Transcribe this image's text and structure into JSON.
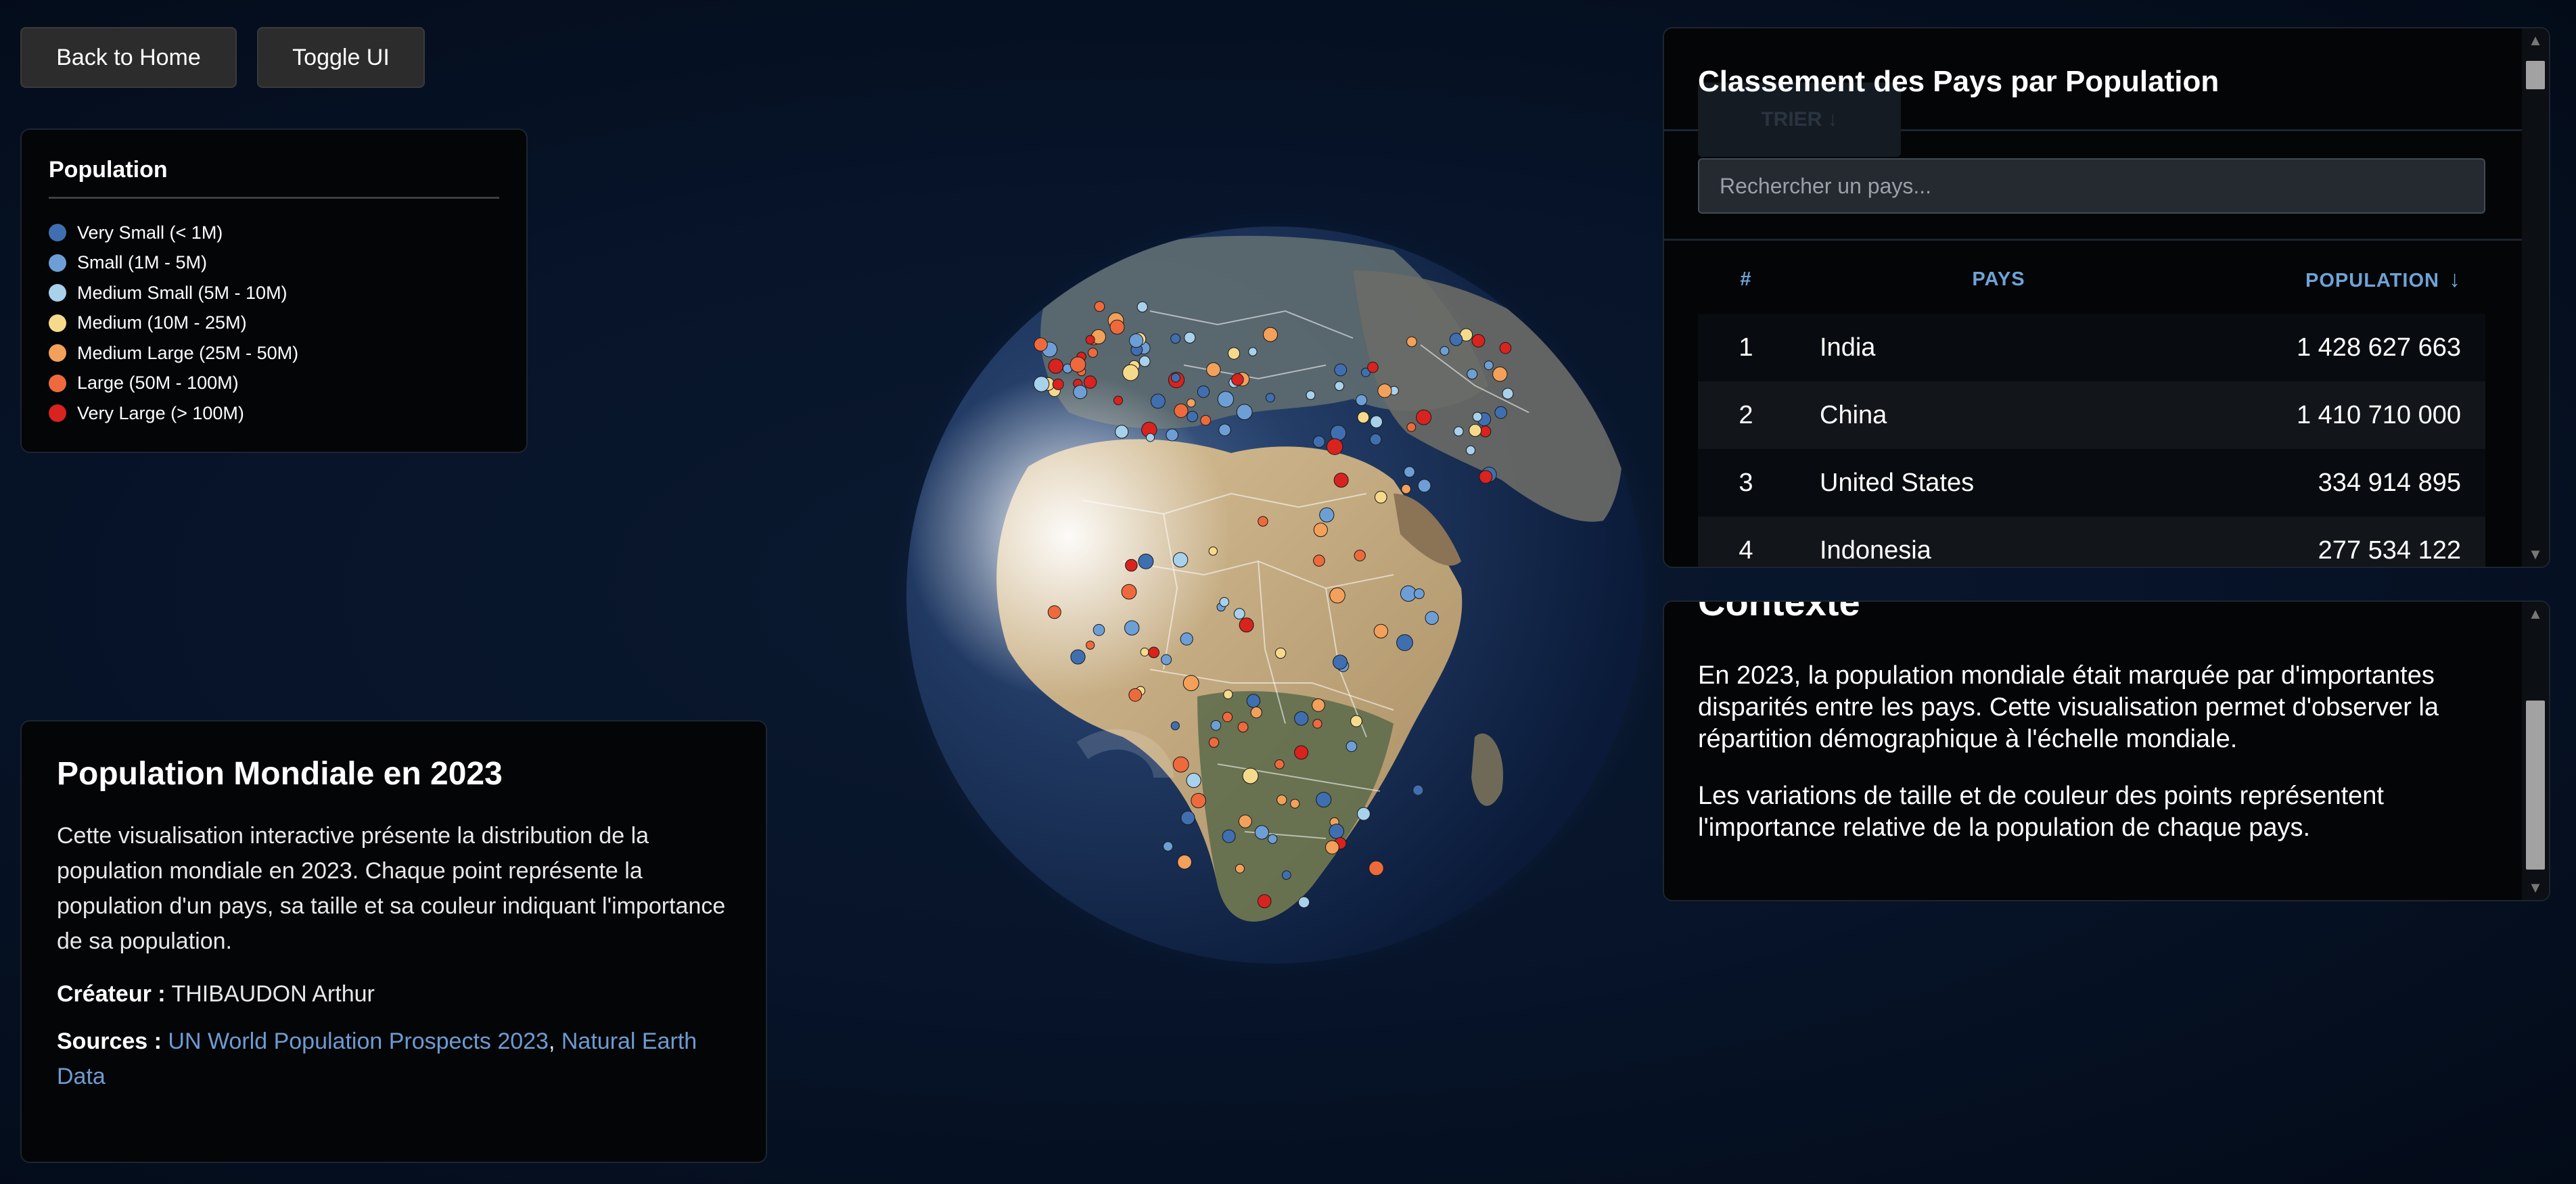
{
  "buttons": {
    "home": "Back to Home",
    "toggle": "Toggle UI"
  },
  "legend": {
    "title": "Population",
    "items": [
      {
        "label": "Very Small (< 1M)",
        "color": "#3f6fb0"
      },
      {
        "label": "Small (1M - 5M)",
        "color": "#6d9fd6"
      },
      {
        "label": "Medium Small (5M - 10M)",
        "color": "#a8d1ec"
      },
      {
        "label": "Medium (10M - 25M)",
        "color": "#f6da8b"
      },
      {
        "label": "Medium Large (25M - 50M)",
        "color": "#f2a05a"
      },
      {
        "label": "Large (50M - 100M)",
        "color": "#ee6a3d"
      },
      {
        "label": "Very Large (> 100M)",
        "color": "#d8231f"
      }
    ]
  },
  "info": {
    "title": "Population Mondiale en 2023",
    "description": "Cette visualisation interactive présente la distribution de la population mondiale en 2023. Chaque point représente la population d'un pays, sa taille et sa couleur indiquant l'importance de sa population.",
    "creator_label": "Créateur :",
    "creator": "THIBAUDON Arthur",
    "sources_label": "Sources :",
    "source1": "UN World Population Prospects 2023",
    "separator": ",",
    "source2": "Natural Earth Data",
    "link_color": "#6e9bd1"
  },
  "ranking": {
    "title": "Classement des Pays par Population",
    "ghost_button": "TRIER ↓",
    "search_placeholder": "Rechercher un pays...",
    "columns": {
      "rank": "#",
      "country": "PAYS",
      "population": "POPULATION",
      "sort_arrow": "↓"
    },
    "rows": [
      {
        "rank": "1",
        "country": "India",
        "population": "1 428 627 663"
      },
      {
        "rank": "2",
        "country": "China",
        "population": "1 410 710 000"
      },
      {
        "rank": "3",
        "country": "United States",
        "population": "334 914 895"
      },
      {
        "rank": "4",
        "country": "Indonesia",
        "population": "277 534 122"
      }
    ]
  },
  "context": {
    "title": "Contexte",
    "p1": "En 2023, la population mondiale était marquée par d'importantes disparités entre les pays. Cette visualisation permet d'observer la répartition démographique à l'échelle mondiale.",
    "p2": "Les variations de taille et de couleur des points représentent l'importance relative de la population de chaque pays."
  },
  "scrollbar": {
    "up": "▲",
    "down": "▼"
  },
  "globe": {
    "label": "world-population-globe"
  }
}
